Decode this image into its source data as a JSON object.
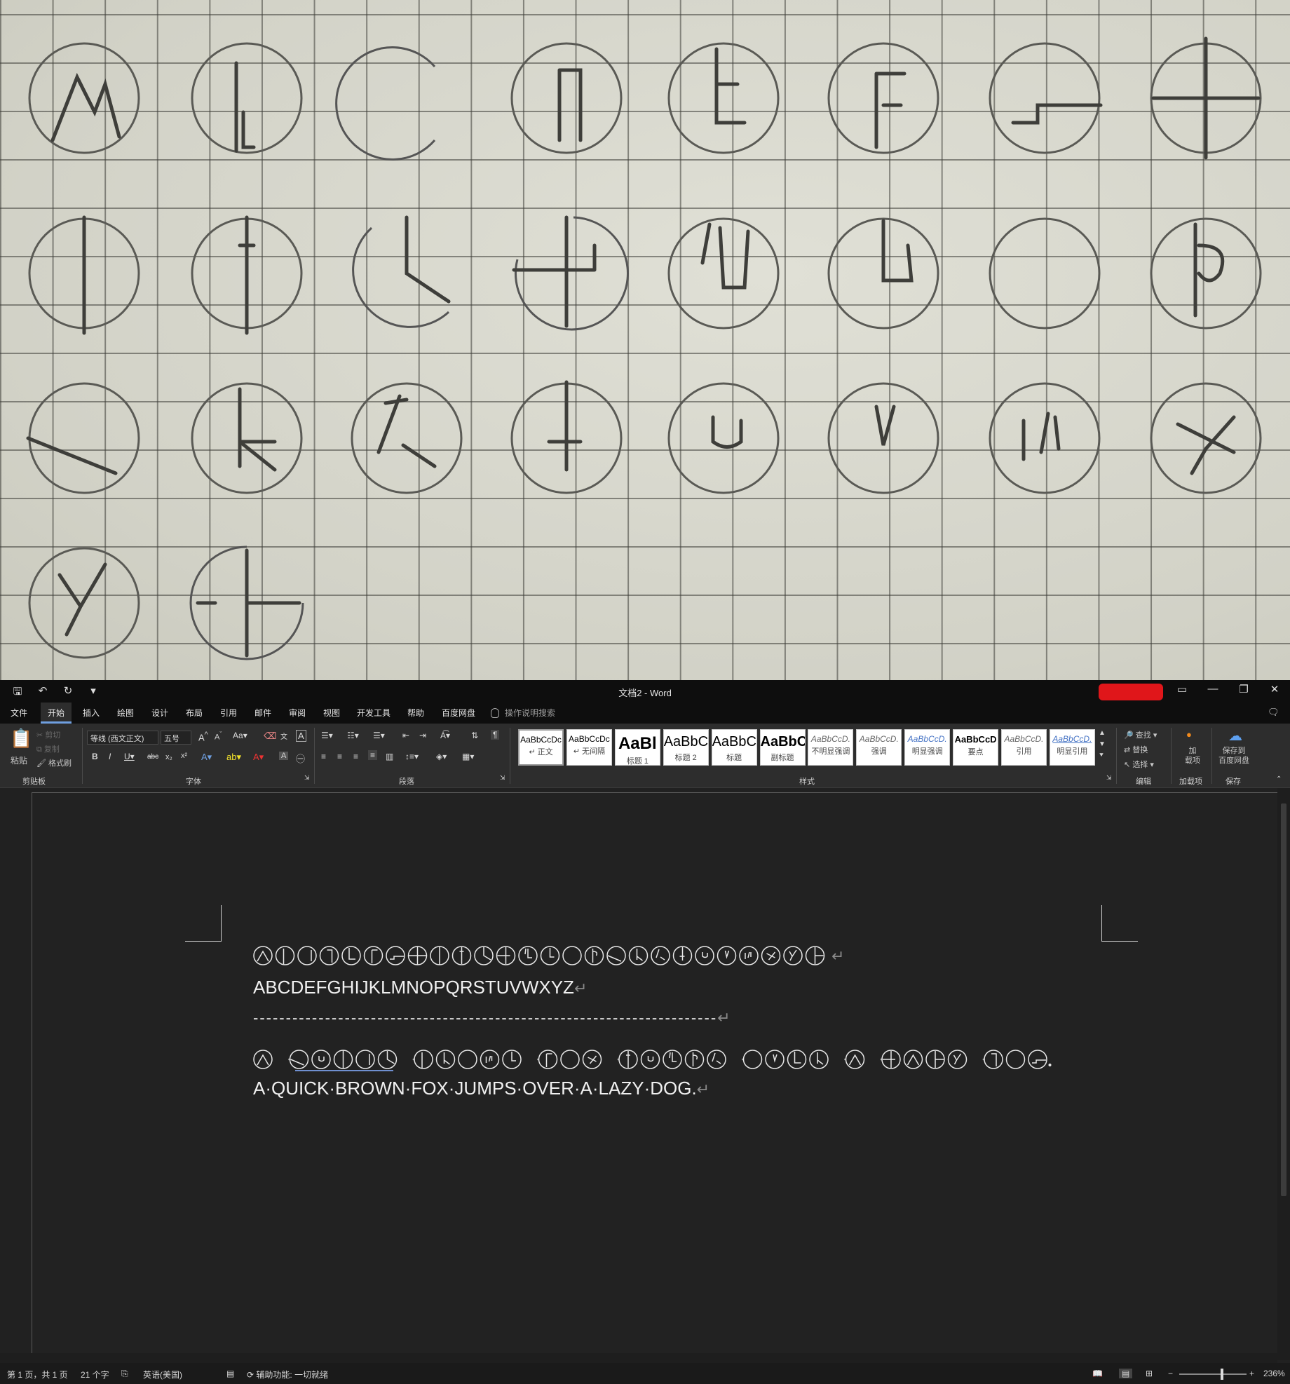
{
  "app": {
    "title": "文档2  -  Word"
  },
  "quick_access": [
    "save-icon",
    "undo-icon",
    "redo-icon",
    "customize-icon"
  ],
  "window_controls": [
    "ribbon-display-icon",
    "minimize-icon",
    "restore-icon",
    "close-icon"
  ],
  "menu": {
    "tabs": [
      "文件",
      "开始",
      "插入",
      "绘图",
      "设计",
      "布局",
      "引用",
      "邮件",
      "审阅",
      "视图",
      "开发工具",
      "帮助",
      "百度网盘"
    ],
    "active_tab": "开始",
    "search_hint": "操作说明搜索"
  },
  "ribbon": {
    "clipboard": {
      "paste": "粘贴",
      "cut": "剪切",
      "copy": "复制",
      "format_painter": "格式刷",
      "label": "剪贴板"
    },
    "font": {
      "font_name": "等线 (西文正文)",
      "font_size": "五号",
      "label": "字体",
      "change_case": "Aa"
    },
    "paragraph": {
      "label": "段落"
    },
    "styles": {
      "label": "样式",
      "items": [
        {
          "sample": "AaBbCcDc",
          "name": "↵ 正文"
        },
        {
          "sample": "AaBbCcDc",
          "name": "↵ 无间隔"
        },
        {
          "sample": "AaBl",
          "name": "标题 1"
        },
        {
          "sample": "AaBbC(",
          "name": "标题 2"
        },
        {
          "sample": "AaBbC(",
          "name": "标题"
        },
        {
          "sample": "AaBbC(",
          "name": "副标题"
        },
        {
          "sample": "AaBbCcD.",
          "name": "不明显强调"
        },
        {
          "sample": "AaBbCcD.",
          "name": "强调"
        },
        {
          "sample": "AaBbCcD.",
          "name": "明显强调"
        },
        {
          "sample": "AaBbCcD",
          "name": "要点"
        },
        {
          "sample": "AaBbCcD.",
          "name": "引用"
        },
        {
          "sample": "AaBbCcD.",
          "name": "明显引用"
        }
      ]
    },
    "editing": {
      "find": "查找",
      "replace": "替换",
      "select": "选择",
      "label": "编辑"
    },
    "addins": {
      "button": "加\n载项",
      "label": "加载项"
    },
    "save": {
      "button": "保存到\n百度网盘",
      "label": "保存"
    }
  },
  "document": {
    "alphabet_line": "ABCDEFGHIJKLMNOPQRSTUVWXYZ",
    "dash_line": "-----------------------------------------------------------------------",
    "sentence": "A·QUICK·BROWN·FOX·JUMPS·OVER·A·LAZY·DOG.",
    "paragraph_mark": "↵"
  },
  "status": {
    "page": "第 1 页，共 1 页",
    "words": "21 个字",
    "language": "英语(美国)",
    "accessibility": "辅助功能: 一切就绪",
    "zoom": "236%"
  },
  "colors": {
    "accent": "#6f9fe0",
    "red_badge": "#e0161a",
    "doc_bg": "#212121"
  }
}
